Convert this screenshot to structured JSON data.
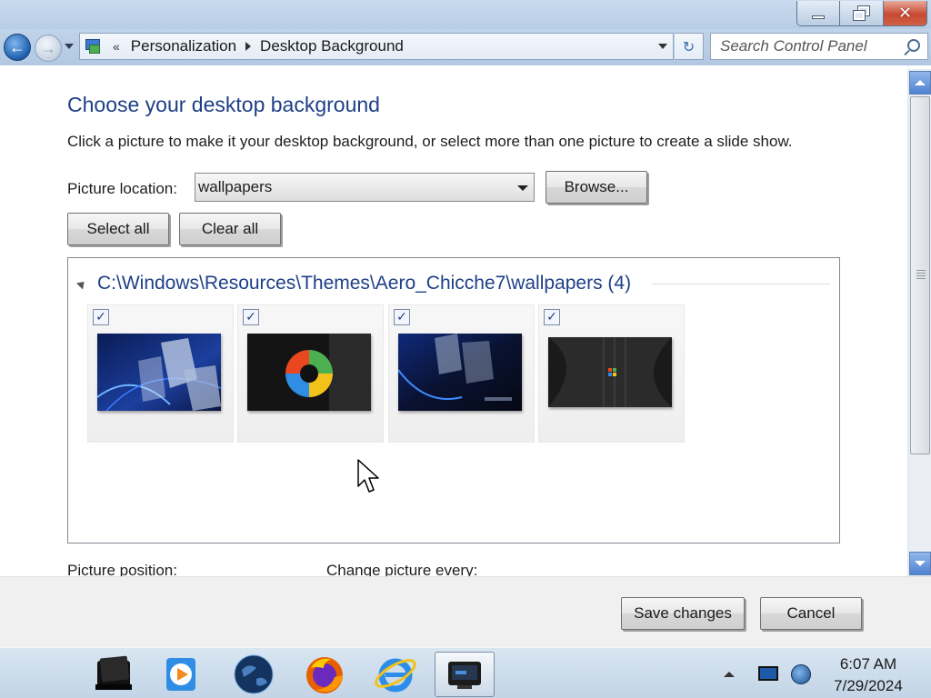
{
  "address": {
    "crumbs": [
      "Personalization",
      "Desktop Background"
    ],
    "overflow": "«"
  },
  "search": {
    "placeholder": "Search Control Panel"
  },
  "page": {
    "title": "Choose your desktop background",
    "description": "Click a picture to make it your desktop background, or select more than one picture to create a slide show.",
    "location_label": "Picture location:",
    "location_value": "wallpapers",
    "browse_label": "Browse...",
    "select_all_label": "Select all",
    "clear_all_label": "Clear all",
    "position_label": "Picture position:",
    "change_label": "Change picture every:"
  },
  "gallery": {
    "group_title": "C:\\Windows\\Resources\\Themes\\Aero_Chicche7\\wallpapers (4)",
    "items": [
      {
        "checked": true,
        "check_mark": "✓",
        "theme": "blue-abstract-glass"
      },
      {
        "checked": true,
        "check_mark": "✓",
        "theme": "windows-orb-dark"
      },
      {
        "checked": true,
        "check_mark": "✓",
        "theme": "blue-abstract-glass-dark"
      },
      {
        "checked": true,
        "check_mark": "✓",
        "theme": "grey-stripes-logo"
      }
    ]
  },
  "footer": {
    "save_label": "Save changes",
    "cancel_label": "Cancel"
  },
  "taskbar": {
    "items": [
      "folder-icon",
      "media-player-icon",
      "globe-icon",
      "firefox-icon",
      "internet-explorer-icon",
      "screen-app-icon"
    ],
    "time": "6:07 AM",
    "date": "7/29/2024"
  },
  "window": {
    "minimize_glyph": "–",
    "close_glyph": "✕",
    "back_glyph": "←",
    "forward_glyph": "→",
    "refresh_glyph": "↻"
  },
  "colors": {
    "accent": "#1e3f87",
    "titlebar": "#bfd3ea",
    "close_button": "#c74a33",
    "taskbar": "#cddcec"
  }
}
